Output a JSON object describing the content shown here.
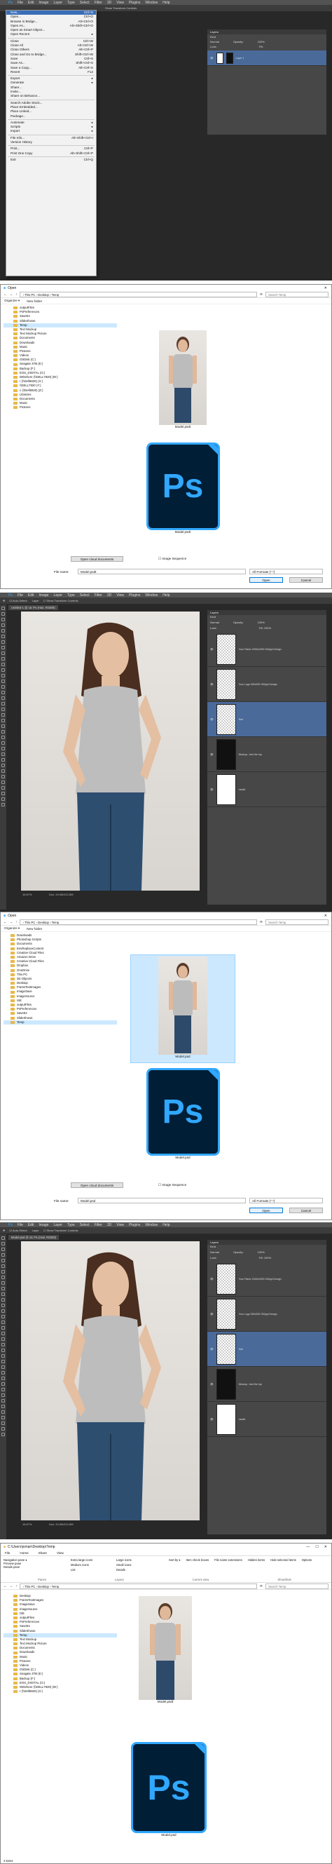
{
  "ps_menu": [
    "File",
    "Edit",
    "Image",
    "Layer",
    "Type",
    "Select",
    "Filter",
    "3D",
    "View",
    "Plugins",
    "Window",
    "Help"
  ],
  "ps_option": {
    "auto_select": "Auto-Select:",
    "layer": "Layer",
    "transform": "Show Transform Controls",
    "mode3d": "3D Mode:"
  },
  "file_menu": [
    {
      "label": "New...",
      "key": "Ctrl+N",
      "hl": true
    },
    {
      "label": "Open...",
      "key": "Ctrl+O"
    },
    {
      "label": "Browse in Bridge...",
      "key": "Alt+Ctrl+O"
    },
    {
      "label": "Open As...",
      "key": "Alt+Shift+Ctrl+O"
    },
    {
      "label": "Open as Smart Object...",
      "key": ""
    },
    {
      "label": "Open Recent",
      "key": "▸"
    },
    {
      "sep": true
    },
    {
      "label": "Close",
      "key": "Ctrl+W"
    },
    {
      "label": "Close All",
      "key": "Alt+Ctrl+W"
    },
    {
      "label": "Close Others",
      "key": "Alt+Ctrl+P"
    },
    {
      "label": "Close and Go to Bridge...",
      "key": "Shift+Ctrl+W"
    },
    {
      "label": "Save",
      "key": "Ctrl+S"
    },
    {
      "label": "Save As...",
      "key": "Shift+Ctrl+S"
    },
    {
      "label": "Save a Copy...",
      "key": "Alt+Ctrl+S"
    },
    {
      "label": "Revert",
      "key": "F12"
    },
    {
      "sep": true
    },
    {
      "label": "Export",
      "key": "▸"
    },
    {
      "label": "Generate",
      "key": "▸"
    },
    {
      "label": "Share...",
      "key": ""
    },
    {
      "label": "Invite...",
      "key": ""
    },
    {
      "label": "Share on Behance...",
      "key": ""
    },
    {
      "sep": true
    },
    {
      "label": "Search Adobe Stock...",
      "key": ""
    },
    {
      "label": "Place Embedded...",
      "key": ""
    },
    {
      "label": "Place Linked...",
      "key": ""
    },
    {
      "label": "Package...",
      "key": ""
    },
    {
      "sep": true
    },
    {
      "label": "Automate",
      "key": "▸"
    },
    {
      "label": "Scripts",
      "key": "▸"
    },
    {
      "label": "Import",
      "key": "▸"
    },
    {
      "sep": true
    },
    {
      "label": "File Info...",
      "key": "Alt+Shift+Ctrl+I"
    },
    {
      "label": "Version History",
      "key": ""
    },
    {
      "sep": true
    },
    {
      "label": "Print...",
      "key": "Ctrl+P"
    },
    {
      "label": "Print One Copy",
      "key": "Alt+Shift+Ctrl+P"
    },
    {
      "sep": true
    },
    {
      "label": "Exit",
      "key": "Ctrl+Q"
    }
  ],
  "layers_panel": {
    "title": "Layers",
    "kind": "Kind",
    "blend": "Normal",
    "opacity_label": "Opacity:",
    "opacity": "100%",
    "lock_label": "Lock:",
    "fill_label": "Fill:",
    "fill": "100%",
    "layer1": "Layer 1"
  },
  "open_dialog": {
    "title": "Open",
    "path": [
      "This PC",
      "Desktop",
      "Temp"
    ],
    "search": "Search Temp",
    "organize": "Organize ▾",
    "new_folder": "New folder",
    "tree1": [
      "outputFiles",
      "PsPreferences",
      "SaveEs",
      "SlideShows",
      "Temp",
      "Text Mockup",
      "Text Mockup Picture",
      "Documents",
      "Downloads",
      "Music",
      "Pictures",
      "Videos",
      "OSDisk (C:)",
      "Seagate 4TB (E:)",
      "Backup (F:)",
      "EOS_DIGITAL (G:)",
      "Writehere (\\\\DELL7920) (W:)",
      "r (\\\\Dell6920) (X:)",
      "\\\\DELL7920 (Y:)",
      "c (\\\\Dell6920) (Z:)",
      "Libraries",
      "Documents",
      "Music",
      "Pictures"
    ],
    "tree1_sel": 4,
    "tree2": [
      "Downloads",
      "Photoshop Scripts",
      "Documents",
      "EnvReplaceContent",
      "Creative Cloud Files",
      "Amazon Drive",
      "Creative Cloud Files",
      "Dropbox",
      "OneDrive",
      "This PC",
      "3D Objects",
      "Desktop",
      "FramsTextImages",
      "ImageSave",
      "ImageSource",
      "ISE",
      "outputFiles",
      "PsPreferences",
      "SaveEs",
      "SlideShows",
      "Temp"
    ],
    "tree2_sel": 20,
    "file1": "Model.psdt",
    "file2": "Model.psdt",
    "file3": "Model.psd",
    "file4": "Model.psd",
    "open_cloud": "Open cloud documents",
    "image_seq": "Image Sequence",
    "filename_label": "File name:",
    "filename1": "Model.psdt",
    "filename2": "Model.psd",
    "format": "All Formats (*.*)",
    "open": "Open",
    "cancel": "Cancel"
  },
  "ps_doc": {
    "tab1": "Untitled-1 @ 16.7% (Hair, RGB/8)",
    "tab2": "Model.psd @ 16.7% (Hair, RGB/8)",
    "zoom": "16.67%",
    "doc_info": "Doc: 24.9M/112.8M"
  },
  "ps_layers2": [
    {
      "name": "Your Fabric 2000x2000 300ppi Design",
      "thumb": "checker"
    },
    {
      "name": "Your Logo 500x500 300ppi Design",
      "thumb": "checker"
    },
    {
      "name": "Hair",
      "thumb": "checker",
      "sel": true
    },
    {
      "name": "Mockup. Just the top",
      "thumb": "dark"
    },
    {
      "name": "model",
      "thumb": "white"
    }
  ],
  "explorer": {
    "title": "C:\\Users\\jvman\\Desktop\\Temp",
    "ribbon_tabs": [
      "File",
      "Home",
      "Share",
      "View"
    ],
    "pane_items": [
      "Navigation pane ▾",
      "Preview pane",
      "Details pane"
    ],
    "layout_items": [
      "Extra large icons",
      "Large icons",
      "Medium icons",
      "Small icons",
      "List",
      "Details"
    ],
    "view_items": [
      "Sort by ▾",
      "Item check boxes",
      "File name extensions",
      "Hidden items",
      "Hide selected items",
      "Options"
    ],
    "groups": [
      "Panes",
      "Layout",
      "Current view",
      "Show/hide"
    ],
    "tree": [
      "Desktop",
      "FramsTextImages",
      "ImageSave",
      "ImageSource",
      "ISE",
      "outputFiles",
      "PsPreferences",
      "SaveEs",
      "SlideShows",
      "Temp",
      "Text Mockup",
      "Text Mockup Picture",
      "Documents",
      "Downloads",
      "Music",
      "Pictures",
      "Videos",
      "OSDisk (C:)",
      "Seagate 4TB (E:)",
      "Backup (F:)",
      "EOS_DIGITAL (G:)",
      "Writehere (\\\\DELL7920) (W:)",
      "r (\\\\Dell6920) (X:)"
    ],
    "tree_sel": 9,
    "file1": "Model.psdt",
    "file2": "Model.psd",
    "status": "2 items"
  }
}
